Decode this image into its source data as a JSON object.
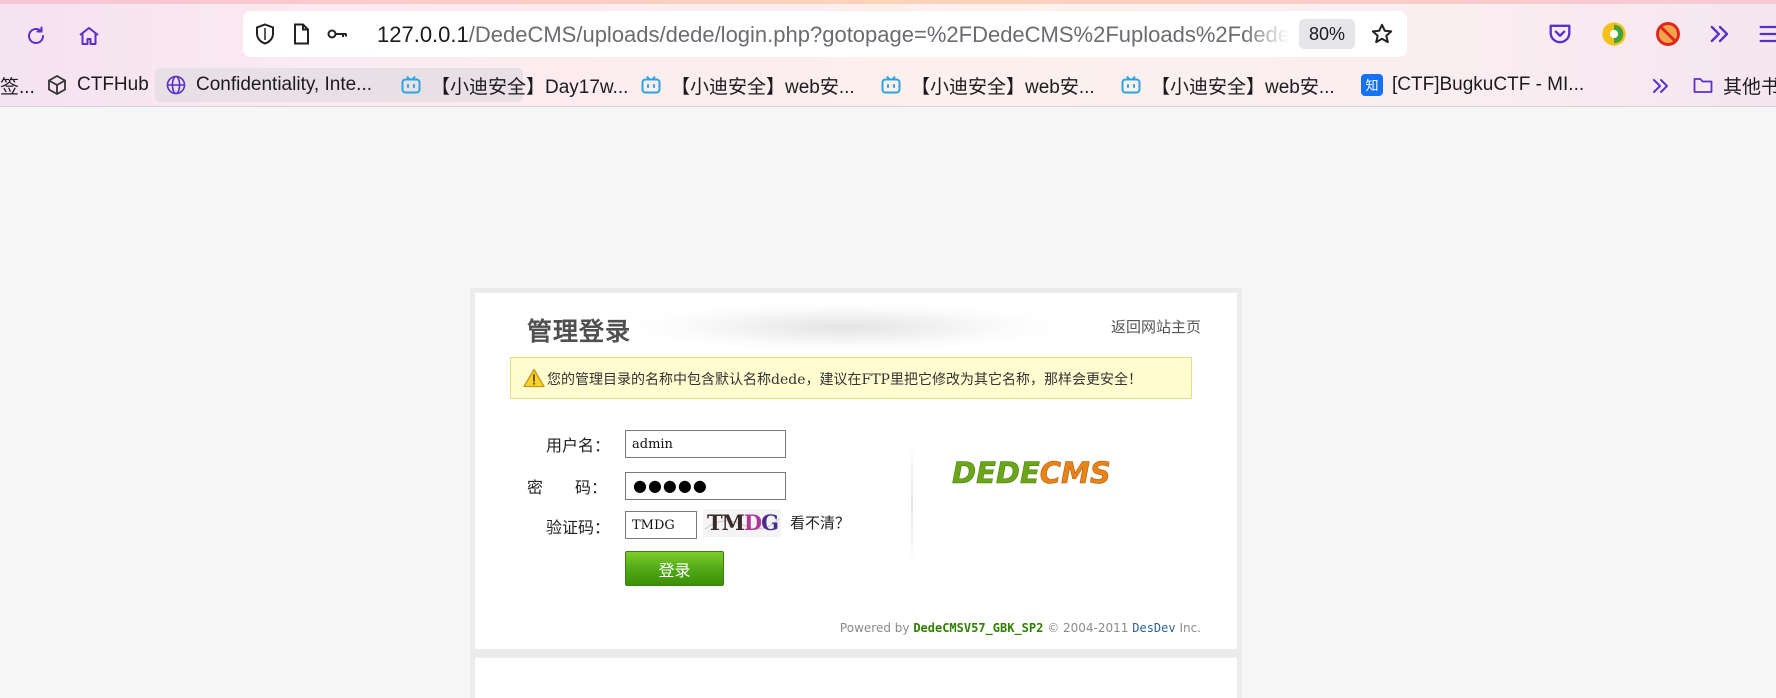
{
  "browser": {
    "url_host": "127.0.0.1",
    "url_path": "/DedeCMS/uploads/dede/login.php?gotopage=%2FDedeCMS%2Fuploads%2Fdede",
    "zoom": "80%",
    "icons": [
      "reload-icon",
      "home-icon",
      "shield-icon",
      "page-icon",
      "key-icon",
      "bookmark-star-icon",
      "pocket-icon",
      "extension-icon",
      "blocked-extension-icon",
      "overflow-chevrons-icon",
      "menu-icon"
    ]
  },
  "bookmarks": [
    {
      "label": "签...",
      "icon": "bookmark-partial"
    },
    {
      "label": "CTFHub",
      "icon": "ctfhub-icon"
    },
    {
      "label": "Confidentiality, Inte...",
      "icon": "globe-icon"
    },
    {
      "label": "【小迪安全】Day17w...",
      "icon": "bilibili-icon"
    },
    {
      "label": "【小迪安全】web安...",
      "icon": "bilibili-icon"
    },
    {
      "label": "【小迪安全】web安...",
      "icon": "bilibili-icon"
    },
    {
      "label": "【小迪安全】web安...",
      "icon": "bilibili-icon"
    },
    {
      "label": "[CTF]BugkuCTF - MI...",
      "icon": "zhihu-icon"
    },
    {
      "label": "其他书",
      "icon": "folder-icon"
    }
  ],
  "login": {
    "title": "管理登录",
    "back_link": "返回网站主页",
    "warning": "您的管理目录的名称中包含默认名称dede，建议在FTP里把它修改为其它名称，那样会更安全！",
    "username_label": "用户名：",
    "username_value": "admin",
    "password_label": "密　　码：",
    "password_dots": "●●●●●",
    "captcha_label": "验证码：",
    "captcha_value": "TMDG",
    "captcha_text": "TMDG",
    "captcha_refresh": "看不清？",
    "submit_label": "登录",
    "logo_text": "DEDECMS"
  },
  "footer": {
    "powered_by": "Powered by",
    "version": "DedeCMSV57_GBK_SP2",
    "copyright": "© 2004-2011",
    "company": "DesDev",
    "suffix": "Inc."
  },
  "colors": {
    "button_green": "#4ea715",
    "logo_green": "#6aa61a",
    "logo_orange": "#e8831a",
    "warning_bg": "#fffdd0"
  }
}
